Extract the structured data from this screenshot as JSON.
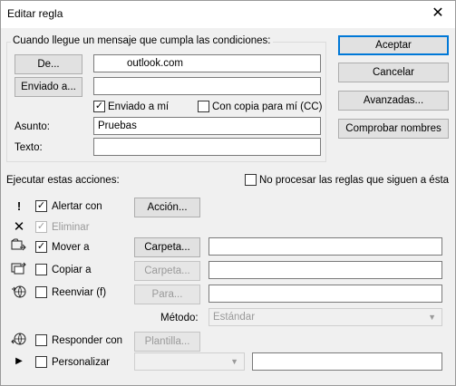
{
  "window": {
    "title": "Editar regla",
    "close_glyph": "✕"
  },
  "conditions": {
    "group_label": "Cuando llegue un mensaje que cumpla las condiciones:",
    "from_button": "De...",
    "from_value": "outlook.com",
    "sent_to_button": "Enviado a...",
    "sent_to_value": "",
    "sent_to_me_label": "Enviado a mí",
    "sent_to_me_checked": true,
    "cc_me_label": "Con copia para mí (CC)",
    "cc_me_checked": false,
    "subject_label": "Asunto:",
    "subject_value": "Pruebas",
    "text_label": "Texto:",
    "text_value": ""
  },
  "side_buttons": {
    "accept": "Aceptar",
    "cancel": "Cancelar",
    "advanced": "Avanzadas...",
    "check_names": "Comprobar nombres"
  },
  "actions": {
    "group_label": "Ejecutar estas acciones:",
    "stop_rules_label": "No procesar las reglas que siguen a ésta",
    "stop_rules_checked": false,
    "alert_label": "Alertar con",
    "alert_checked": true,
    "alert_button": "Acción...",
    "delete_label": "Eliminar",
    "delete_checked": true,
    "move_label": "Mover a",
    "move_checked": true,
    "move_button": "Carpeta...",
    "move_value": "",
    "copy_label": "Copiar a",
    "copy_checked": false,
    "copy_button": "Carpeta...",
    "copy_value": "",
    "forward_label": "Reenviar (f)",
    "forward_checked": false,
    "forward_button": "Para...",
    "forward_value": "",
    "method_label": "Método:",
    "method_value": "Estándar",
    "reply_label": "Responder con",
    "reply_checked": false,
    "reply_button": "Plantilla...",
    "reply_value": "",
    "custom_label": "Personalizar",
    "custom_checked": false,
    "custom_value": ""
  },
  "icons": {
    "alert": "exclamation-icon",
    "delete": "x-icon",
    "move": "move-folder-icon",
    "copy": "copy-folder-icon",
    "forward": "forward-globe-icon",
    "reply": "reply-globe-icon",
    "custom": "play-arrow-icon"
  }
}
